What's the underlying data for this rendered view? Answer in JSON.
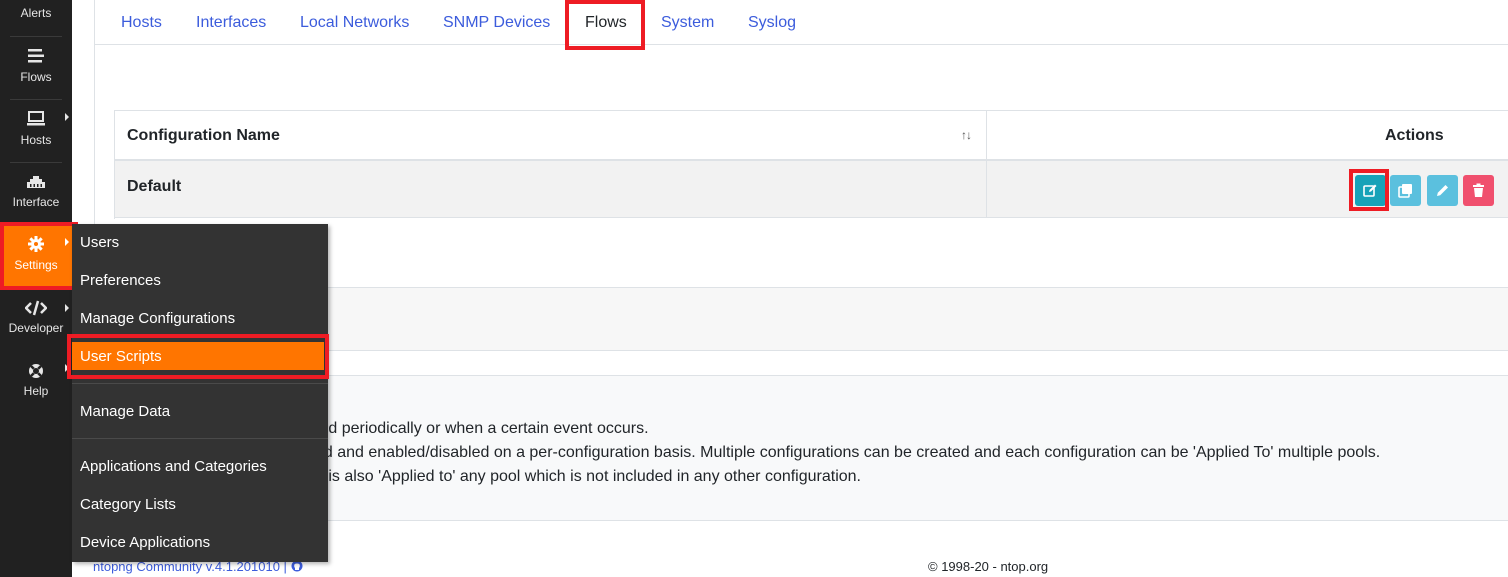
{
  "sidebar": {
    "items": [
      {
        "label": "Alerts",
        "icon": "bell-icon"
      },
      {
        "label": "Flows",
        "icon": "flows-icon"
      },
      {
        "label": "Hosts",
        "icon": "laptop-icon"
      },
      {
        "label": "Interface",
        "icon": "ethernet-icon"
      },
      {
        "label": "Settings",
        "icon": "gear-icon"
      },
      {
        "label": "Developer",
        "icon": "code-icon"
      },
      {
        "label": "Help",
        "icon": "lifebuoy-icon"
      }
    ],
    "active_color": "#ff7500"
  },
  "tabs": [
    {
      "label": "Hosts"
    },
    {
      "label": "Interfaces"
    },
    {
      "label": "Local Networks"
    },
    {
      "label": "SNMP Devices"
    },
    {
      "label": "Flows"
    },
    {
      "label": "System"
    },
    {
      "label": "Syslog"
    }
  ],
  "active_tab": "Flows",
  "table": {
    "col_name": "Configuration Name",
    "col_actions": "Actions",
    "rows": [
      {
        "name": "Default"
      }
    ],
    "action_buttons": [
      {
        "icon": "edit-icon",
        "color": "#17a2b8"
      },
      {
        "icon": "clone-icon",
        "color": "#5bc0de"
      },
      {
        "icon": "pencil-icon",
        "color": "#5bc0de"
      },
      {
        "icon": "trash-icon",
        "color": "#f0506e"
      }
    ]
  },
  "notes": [
    "ted periodically or when a certain event occurs.",
    "ed and enabled/disabled on a per-configuration basis. Multiple configurations can be created and each configuration can be 'Applied To' multiple pools.",
    "n is also 'Applied to' any pool which is not included in any other configuration."
  ],
  "footer": {
    "version": "ntopng Community v.4.1.201010 |",
    "copyright": "© 1998-20 - ntop.org"
  },
  "dropdown": {
    "items": [
      {
        "label": "Users"
      },
      {
        "label": "Preferences"
      },
      {
        "label": "Manage Configurations"
      },
      {
        "label": "User Scripts"
      },
      {
        "label": "Manage Data"
      },
      {
        "label": "Applications and Categories"
      },
      {
        "label": "Category Lists"
      },
      {
        "label": "Device Applications"
      }
    ],
    "active_item": "User Scripts"
  },
  "highlight_color": "#ee1c24"
}
